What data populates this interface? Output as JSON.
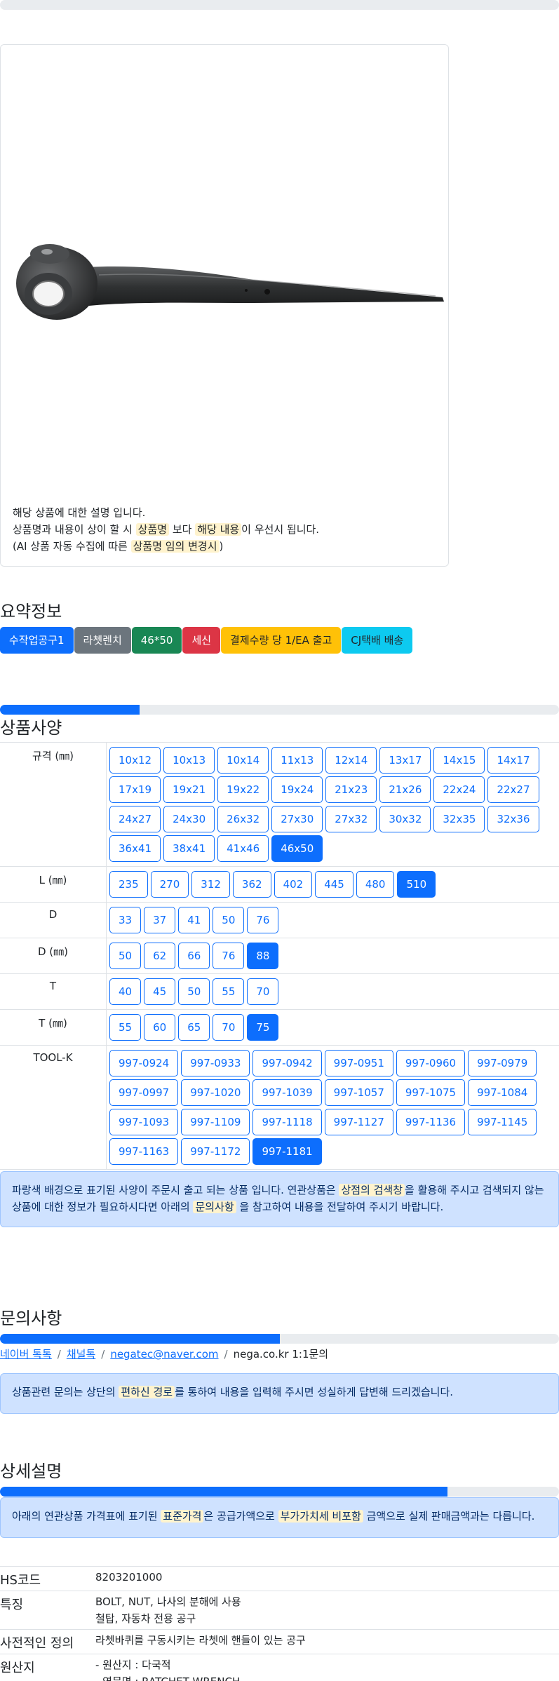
{
  "product": {
    "description_lines": [
      "해당 상품에 대한 설명 입니다.",
      [
        "상품명과 내용이 상이 할 시 ",
        "상품명",
        " 보다 ",
        "해당 내용",
        "이 우선시 됩니다."
      ],
      [
        "(AI 상품 자동 수집에 따른 ",
        "상품명 임의 변경시",
        ")"
      ]
    ]
  },
  "summary": {
    "title": "요약정보",
    "badges": [
      {
        "label": "수작업공구1",
        "color": "#0d6efd"
      },
      {
        "label": "라쳇렌치",
        "color": "#6c757d"
      },
      {
        "label": "46*50",
        "color": "#198754"
      },
      {
        "label": "세신",
        "color": "#dc3545"
      },
      {
        "label": "결제수량 당 1/EA 출고",
        "color": "#ffc107",
        "text_color": "#212529"
      },
      {
        "label": "CJ택배 배송",
        "color": "#0dcaf0",
        "text_color": "#212529"
      }
    ]
  },
  "specs": {
    "title": "상품사양",
    "progress": 0.25,
    "rows": [
      {
        "label": "규격 (㎜)",
        "options": [
          "10x12",
          "10x13",
          "10x14",
          "11x13",
          "12x14",
          "13x17",
          "14x15",
          "14x17",
          "17x19",
          "19x21",
          "19x22",
          "19x24",
          "21x23",
          "21x26",
          "22x24",
          "22x27",
          "24x27",
          "24x30",
          "26x32",
          "27x30",
          "27x32",
          "30x32",
          "32x35",
          "32x36",
          "36x41",
          "38x41",
          "41x46",
          "46x50"
        ],
        "selected": "46x50"
      },
      {
        "label": "L (㎜)",
        "options": [
          "235",
          "270",
          "312",
          "362",
          "402",
          "445",
          "480",
          "510"
        ],
        "selected": "510"
      },
      {
        "label": "D",
        "options": [
          "33",
          "37",
          "41",
          "50",
          "76"
        ],
        "selected": ""
      },
      {
        "label": "D (㎜)",
        "options": [
          "50",
          "62",
          "66",
          "76",
          "88"
        ],
        "selected": "88"
      },
      {
        "label": "T",
        "options": [
          "40",
          "45",
          "50",
          "55",
          "70"
        ],
        "selected": ""
      },
      {
        "label": "T (㎜)",
        "options": [
          "55",
          "60",
          "65",
          "70",
          "75"
        ],
        "selected": "75"
      },
      {
        "label": "TOOL-K",
        "options": [
          "997-0924",
          "997-0933",
          "997-0942",
          "997-0951",
          "997-0960",
          "997-0979",
          "997-0997",
          "997-1020",
          "997-1039",
          "997-1057",
          "997-1075",
          "997-1084",
          "997-1093",
          "997-1109",
          "997-1118",
          "997-1127",
          "997-1136",
          "997-1145",
          "997-1163",
          "997-1172",
          "997-1181"
        ],
        "selected": "997-1181"
      }
    ],
    "notice": [
      "파랑색 배경으로 표기된 사양이 주문시 출고 되는 상품 입니다. 연관상품은 ",
      "상점의 검색창",
      "을 활용해 주시고 검색되지 않는 상품에 대한 정보가 필요하시다면 아래의 ",
      "문의사항",
      " 을 참고하여 내용을 전달하여 주시기 바랍니다."
    ]
  },
  "inquiry": {
    "title": "문의사항",
    "progress": 0.5,
    "links": [
      "네이버 톡톡",
      "채널톡",
      "negatec@naver.com"
    ],
    "plain": "nega.co.kr 1:1문의",
    "notice": [
      "상품관련 문의는 상단의 ",
      "편하신 경로",
      "를 통하여 내용을 입력해 주시면 성실하게 답변해 드리겠습니다."
    ]
  },
  "detail": {
    "title": "상세설명",
    "progress": 0.8,
    "notice": [
      "아래의 연관상품 가격표에 표기된 ",
      "표준가격",
      "은 공급가액으로 ",
      "부가가치세 비포함",
      " 금액으로 실제 판매금액과는 다릅니다."
    ],
    "rows": [
      {
        "label": "HS코드",
        "values": [
          "8203201000"
        ]
      },
      {
        "label": "특징",
        "values": [
          "BOLT, NUT, 나사의 분해에 사용",
          "철탑, 자동차 전용 공구"
        ]
      },
      {
        "label": "사전적인 정의",
        "values": [
          "라쳇바퀴를 구동시키는 라쳇에 핸들이 있는 공구"
        ]
      },
      {
        "label": "원산지",
        "values": [
          "- 원산지 : 다국적",
          "- 영문명 : RATCHET WRENCH"
        ]
      }
    ]
  }
}
